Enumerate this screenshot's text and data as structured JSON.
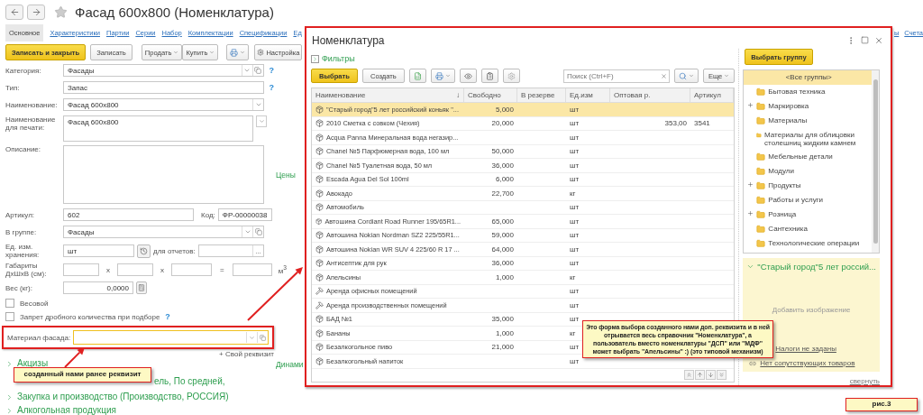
{
  "window": {
    "title": "Фасад 600x800 (Номенклатура)",
    "favorite": false
  },
  "tabs": [
    {
      "label": "Основное",
      "selected": true
    },
    {
      "label": "Характеристики",
      "selected": false
    },
    {
      "label": "Партии",
      "selected": false
    },
    {
      "label": "Серии",
      "selected": false
    },
    {
      "label": "Набор",
      "selected": false
    },
    {
      "label": "Комплектации",
      "selected": false
    },
    {
      "label": "Спецификации",
      "selected": false
    },
    {
      "label": "Ед",
      "selected": false
    }
  ],
  "tabs_right": [
    "ы",
    "Счета"
  ],
  "toolbar": {
    "primary": "Записать и закрыть",
    "save": "Записать",
    "sell": "Продать",
    "buy": "Купить",
    "settings": "Настройка"
  },
  "form": {
    "category": {
      "label": "Категория:",
      "value": "Фасады",
      "help": "?"
    },
    "type": {
      "label": "Тип:",
      "value": "Запас",
      "help": "?"
    },
    "name": {
      "label": "Наименование:",
      "value": "Фасад 600x800"
    },
    "print_name": {
      "label": "Наименование для печати:",
      "value": "Фасад 600x800"
    },
    "description": {
      "label": "Описание:"
    },
    "article": {
      "label": "Артикул:",
      "value": "602"
    },
    "code": {
      "label": "Код:",
      "value": "ФР-00000038"
    },
    "group": {
      "label": "В группе:",
      "value": "Фасады"
    },
    "unit": {
      "label": "Ед. изм. хранения:",
      "value": "шт",
      "report_label": "для отчетов:",
      "report_button": "..."
    },
    "dimensions": {
      "label": "Габариты ДхШхВ (см):",
      "sep1": "x",
      "sep2": "x",
      "eq": "=",
      "unit": "м$^{3}$"
    },
    "weight": {
      "label": "Вес (кг):",
      "value": "0,0000"
    },
    "checkboxes": [
      {
        "label": "Весовой",
        "checked": false
      },
      {
        "label": "Запрет дробного количества при подборе",
        "checked": false,
        "help": "?"
      }
    ],
    "material": {
      "label": "Материал фасада:",
      "focused": true
    },
    "add_attribute": "+ Свой реквизит"
  },
  "sections": [
    {
      "kind": "group",
      "label": "Акцизы"
    },
    {
      "kind": "clipped",
      "label": "ель, По средней,"
    },
    {
      "kind": "group",
      "label": "Закупка и производство (Производство, РОССИЯ)"
    },
    {
      "kind": "group",
      "label": "Алкогольная продукция"
    }
  ],
  "side_headings": [
    "Цены",
    "Динами"
  ],
  "modal": {
    "title": "Номенклатура",
    "filters": "Фильтры",
    "select": "Выбрать",
    "create": "Создать",
    "search_placeholder": "Поиск (Ctrl+F)",
    "more": "Еще",
    "columns": [
      "Наименование",
      "Свободно",
      "В резерве",
      "Ед.изм",
      "Оптовая р.",
      "Артикул"
    ],
    "sort_mark": "↓",
    "rows": [
      {
        "kind": "goods",
        "name": "\"Старый город\"5 лет российский коньяк \"...",
        "free": "5,000",
        "unit": "шт",
        "selected": true
      },
      {
        "kind": "goods",
        "name": "2010 Сметка с совком (Чехия)",
        "free": "20,000",
        "unit": "шт",
        "wholesale": "353,00",
        "article": "3541",
        "selected": false
      },
      {
        "kind": "goods",
        "name": "Acqua Panna Минеральная вода негазир...",
        "unit": "шт",
        "selected": false
      },
      {
        "kind": "goods",
        "name": "Chanel №5 Парфюмерная вода, 100 мл",
        "free": "50,000",
        "unit": "шт",
        "selected": false
      },
      {
        "kind": "goods",
        "name": "Chanel №5 Туалетная вода, 50 мл",
        "free": "36,000",
        "unit": "шт",
        "selected": false
      },
      {
        "kind": "goods",
        "name": "Escada Agua Del Sol 100ml",
        "free": "6,000",
        "unit": "шт",
        "selected": false
      },
      {
        "kind": "goods",
        "name": "Авокадо",
        "free": "22,700",
        "unit": "кг",
        "selected": false
      },
      {
        "kind": "goods",
        "name": "Автомобиль",
        "unit": "шт",
        "selected": false
      },
      {
        "kind": "goods",
        "name": "Автошина Cordiant Road Runner 195/65R1...",
        "free": "65,000",
        "unit": "шт",
        "selected": false
      },
      {
        "kind": "goods",
        "name": "Автошина Nokian Nordman SZ2 225/55R1...",
        "free": "59,000",
        "unit": "шт",
        "selected": false
      },
      {
        "kind": "goods",
        "name": "Автошина Nokian WR SUV 4 225/60 R 17 ...",
        "free": "64,000",
        "unit": "шт",
        "selected": false
      },
      {
        "kind": "goods",
        "name": "Антисептик для рук",
        "free": "36,000",
        "unit": "шт",
        "selected": false
      },
      {
        "kind": "goods",
        "name": "Апельсины",
        "free": "1,000",
        "unit": "кг",
        "selected": false
      },
      {
        "kind": "service",
        "name": "Аренда офисных помещений",
        "unit": "шт",
        "selected": false
      },
      {
        "kind": "service",
        "name": "Аренда производственных помещений",
        "unit": "шт",
        "selected": false
      },
      {
        "kind": "goods",
        "name": "БАД №1",
        "free": "35,000",
        "unit": "шт",
        "selected": false
      },
      {
        "kind": "goods",
        "name": "Бананы",
        "free": "1,000",
        "unit": "кг",
        "selected": false
      },
      {
        "kind": "goods",
        "name": "Безалкогольное пиво",
        "free": "21,000",
        "unit": "шт",
        "selected": false
      },
      {
        "kind": "goods",
        "name": "Безалкогольный напиток",
        "unit": "шт",
        "selected": false
      }
    ],
    "group_button": "Выбрать группу",
    "groups": [
      {
        "label": "<Все группы>",
        "expandable": false,
        "selected": true
      },
      {
        "label": "Бытовая техника",
        "expandable": false,
        "selected": false
      },
      {
        "label": "Маркировка",
        "expandable": true,
        "selected": false
      },
      {
        "label": "Материалы",
        "expandable": false,
        "selected": false
      },
      {
        "label": "Материалы для облицовки столешниц жидким камнем",
        "expandable": false,
        "selected": false
      },
      {
        "label": "Мебельные детали",
        "expandable": false,
        "selected": false
      },
      {
        "label": "Модули",
        "expandable": false,
        "selected": false
      },
      {
        "label": "Продукты",
        "expandable": true,
        "selected": false
      },
      {
        "label": "Работы и услуги",
        "expandable": false,
        "selected": false
      },
      {
        "label": "Розница",
        "expandable": true,
        "selected": false
      },
      {
        "label": "Сантехника",
        "expandable": false,
        "selected": false
      },
      {
        "label": "Технологические операции",
        "expandable": false,
        "selected": false
      }
    ],
    "details": {
      "title": "\"Старый город\"5 лет россий...",
      "add_image": "Добавить изображение",
      "taxes": "Налоги не заданы",
      "related": "Нет сопутствующих товаров",
      "collapse": "свернуть"
    }
  },
  "callouts": {
    "field": "созданный нами ранее реквизит",
    "modal": "Это форма выбора созданного нами доп. реквизита и в ней отрывается весь справочник \"Номенклатура\", а пользователь вместо номенклатуры \"ДСП\" или \"МДФ\" может выбрать \"Апельсины\" :) (это типовой механизм)"
  },
  "figure_label": "рис.3"
}
